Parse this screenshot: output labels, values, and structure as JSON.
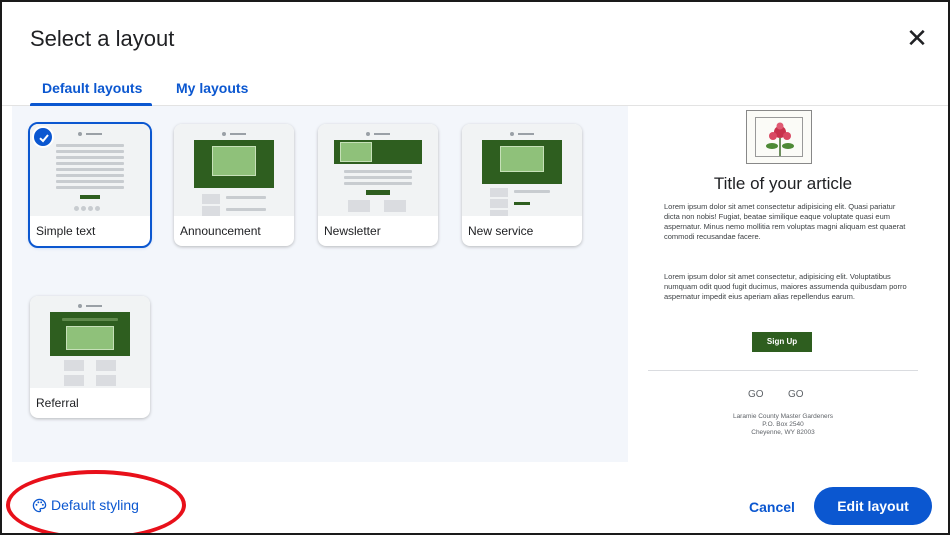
{
  "dialog": {
    "title": "Select a layout",
    "close_icon": "close-icon"
  },
  "tabs": [
    {
      "label": "Default layouts",
      "active": true
    },
    {
      "label": "My layouts",
      "active": false
    }
  ],
  "layouts": [
    {
      "label": "Simple text",
      "selected": true
    },
    {
      "label": "Announcement",
      "selected": false
    },
    {
      "label": "Newsletter",
      "selected": false
    },
    {
      "label": "New service",
      "selected": false
    },
    {
      "label": "Referral",
      "selected": false
    }
  ],
  "preview": {
    "logo": "LARAMIE COUNTY MASTER GARDENERS",
    "title": "Title of your article",
    "paragraph1": "Lorem ipsum dolor sit amet consectetur adipisicing elit. Quasi pariatur dicta non nobis! Fugiat, beatae similique eaque voluptate quasi eum aspernatur. Minus nemo mollitia rem voluptas magni aliquam est quaerat commodi recusandae facere.",
    "paragraph2": "Lorem ipsum dolor sit amet consectetur, adipisicing elit. Voluptatibus numquam odit quod fugit ducimus, maiores assumenda quibusdam porro aspernatur impedit eius aperiam alias repellendus earum.",
    "button": "Sign Up",
    "link1": "GO",
    "link2": "GO",
    "address_line1": "Laramie County Master Gardeners",
    "address_line2": "P.O. Box 2540",
    "address_line3": "Cheyenne, WY 82003"
  },
  "footer": {
    "styling_label": "Default styling",
    "cancel_label": "Cancel",
    "edit_label": "Edit layout"
  },
  "colors": {
    "accent": "#0b57d0",
    "brand_green": "#2e5e1f",
    "annotation": "#e8101a"
  }
}
